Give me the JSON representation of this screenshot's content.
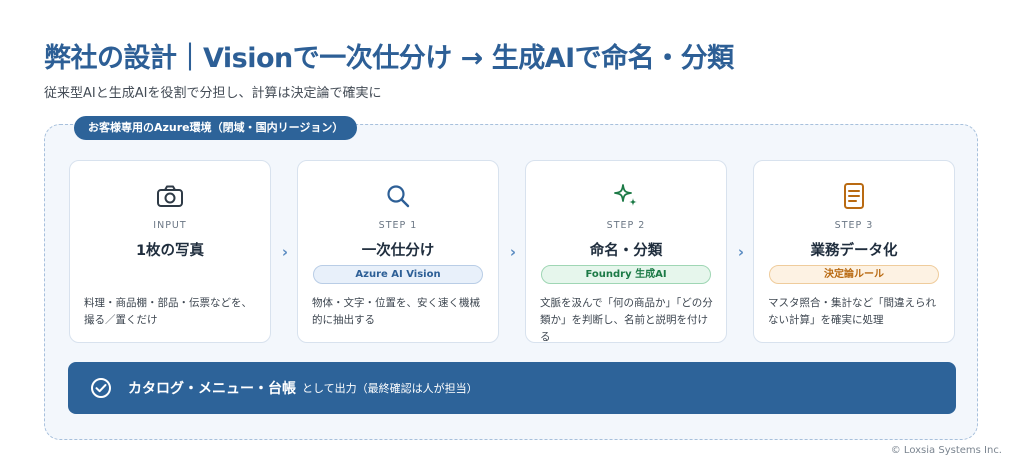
{
  "header": {
    "title": "弊社の設計｜Visionで一次仕分け → 生成AIで命名・分類",
    "subtitle": "従来型AIと生成AIを役割で分担し、計算は決定論で確実に"
  },
  "environment": {
    "label": "お客様専用のAzure環境（閉域・国内リージョン）"
  },
  "steps": [
    {
      "step_label": "INPUT",
      "name": "1枚の写真",
      "badge": "",
      "description": "料理・商品棚・部品・伝票などを、撮る／置くだけ",
      "icon": "camera-icon"
    },
    {
      "step_label": "STEP 1",
      "name": "一次仕分け",
      "badge": "Azure AI Vision",
      "description": "物体・文字・位置を、安く速く機械的に抽出する",
      "icon": "search-icon"
    },
    {
      "step_label": "STEP 2",
      "name": "命名・分類",
      "badge": "Foundry 生成AI",
      "description": "文脈を汲んで「何の商品か」「どの分類か」を判断し、名前と説明を付ける",
      "icon": "sparkle-icon"
    },
    {
      "step_label": "STEP 3",
      "name": "業務データ化",
      "badge": "決定論ルール",
      "description": "マスタ照合・集計など「間違えられない計算」を確実に処理",
      "icon": "document-icon"
    }
  ],
  "output": {
    "main": "カタログ・メニュー・台帳",
    "note": "として出力（最終確認は人が担当）",
    "icon": "check-circle-icon"
  },
  "footer": {
    "copyright": "© Loxsia Systems Inc."
  },
  "colors": {
    "primary": "#2d6399",
    "title": "#2d5f96",
    "green": "#1c7a46",
    "orange": "#b96a12"
  }
}
